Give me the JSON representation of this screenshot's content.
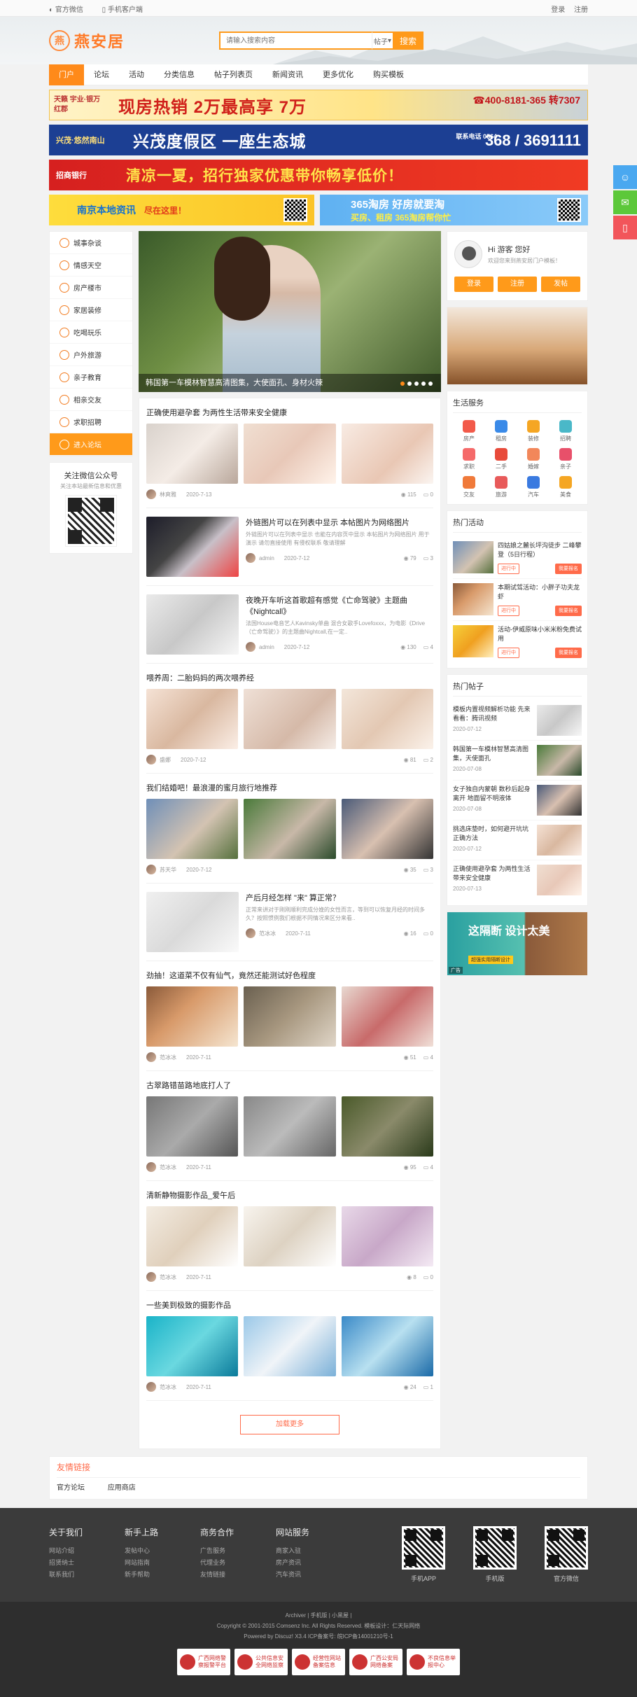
{
  "topbar": {
    "wechat": "官方微信",
    "mobile": "手机客户端",
    "login": "登录",
    "register": "注册"
  },
  "header": {
    "logo_char": "燕",
    "logo_text": "燕安居",
    "search_placeholder": "请输入搜索内容",
    "search_scope": "帖子",
    "search_button": "搜索"
  },
  "nav": [
    "门户",
    "论坛",
    "活动",
    "分类信息",
    "帖子列表页",
    "新闻资讯",
    "更多优化",
    "购买模板"
  ],
  "banners": {
    "b1_logo": "天籁 宇业·银万红郡",
    "b1_text": "现房热销 2万最高享 7万",
    "b1_phone": "☎400-8181-365 转7307",
    "b2_logo": "兴茂·悠然南山",
    "b2_text": "兴茂度假区 一座生态城",
    "b2_small": "联系电话 0564",
    "b2_phone": "368 / 3691111",
    "b3_logo": "招商银行",
    "b3_text": "清凉一夏，招行独家优惠带你畅享低价！",
    "b4a_text": "南京本地资讯",
    "b4a_sub": "尽在这里！",
    "b4b_text": "365淘房 好房就要淘",
    "b4b_sub": "买房、租房 365淘房帮你忙"
  },
  "left_nav": [
    "城事杂谈",
    "情感天空",
    "房产楼市",
    "家居装修",
    "吃喝玩乐",
    "户外旅游",
    "亲子教育",
    "相亲交友",
    "求职招聘",
    "进入论坛"
  ],
  "wechat_box": {
    "title": "关注微信公众号",
    "sub": "关注本站最新信息和优惠"
  },
  "slider": {
    "caption": "韩国第一车模林智慧高清图集，大使面孔、身材火辣"
  },
  "posts": [
    {
      "title": "正确使用避孕套 为两性生活带来安全健康",
      "author": "林爽雅",
      "date": "2020-7-13",
      "views": "115",
      "comments": "0"
    },
    {
      "title": "外链图片可以在列表中显示 本帖图片为网络图片",
      "desc": "外链图片可以在列表中显示 也能在内容页中显示 本帖图片为网络图片 用于演示 请勿直接使用 有侵权联系 敬请理解",
      "author": "admin",
      "date": "2020-7-12",
      "views": "79",
      "comments": "3"
    },
    {
      "title": "夜晚开车听这首歌超有感觉《亡命驾驶》主题曲《Nightcall》",
      "desc": "法国House电音艺人Kavinsky单曲 混合女歌手Lovefoxxx，为电影《Drive（亡命驾驶）》的主题曲Nightcall,在一定..",
      "author": "admin",
      "date": "2020-7-12",
      "views": "130",
      "comments": "4"
    },
    {
      "title": "喂养周：二胎妈妈的两次喂养经",
      "author": "盛娜",
      "date": "2020-7-12",
      "views": "81",
      "comments": "2"
    },
    {
      "title": "我们结婚吧！最浪漫的蜜月旅行地推荐",
      "author": "苏天华",
      "date": "2020-7-12",
      "views": "35",
      "comments": "3"
    },
    {
      "title": "产后月经怎样 \"来\" 算正常？",
      "desc": "正常来讲对于刚刚顺利完成分娩的女性而言，等到可以恢复月经的时间多久？按照惯例我们根据不同情况来区分来看..",
      "author": "范冰冰",
      "date": "2020-7-11",
      "views": "16",
      "comments": "0"
    },
    {
      "title": "劲抽！这道菜不仅有仙气，竟然还能测试好色程度",
      "author": "范冰冰",
      "date": "2020-7-11",
      "views": "51",
      "comments": "4"
    },
    {
      "title": "古翠路错苗路地底打人了",
      "author": "范冰冰",
      "date": "2020-7-11",
      "views": "95",
      "comments": "4"
    },
    {
      "title": "清新静物摄影作品_爱午后",
      "author": "范冰冰",
      "date": "2020-7-11",
      "views": "8",
      "comments": "0"
    },
    {
      "title": "一些美到极致的摄影作品",
      "author": "范冰冰",
      "date": "2020-7-11",
      "views": "24",
      "comments": "1"
    }
  ],
  "load_more": "加载更多",
  "user": {
    "greeting": "Hi 游客 您好",
    "welcome": "欢迎您来到燕安居门户模板！",
    "btn_login": "登录",
    "btn_register": "注册",
    "btn_post": "发帖"
  },
  "services": {
    "title": "生活服务",
    "items": [
      "房产",
      "租房",
      "装修",
      "招聘",
      "求职",
      "二手",
      "婚嫁",
      "亲子",
      "交友",
      "旅游",
      "汽车",
      "美食"
    ]
  },
  "activities": {
    "title": "热门活动",
    "items": [
      {
        "title": "四姑娘之麓长坪沟徒步 二峰攀登（5日行程）",
        "status": "进行中",
        "btn": "我要报名"
      },
      {
        "title": "本期试驾活动：小胖子功夫龙虾",
        "status": "进行中",
        "btn": "我要报名"
      },
      {
        "title": "活动-伊威原味小米米粉免费试用",
        "status": "进行中",
        "btn": "我要报名"
      }
    ]
  },
  "hot_posts": {
    "title": "热门帖子",
    "items": [
      {
        "title": "模板内置视频解析功能 先来看看：腾讯视频",
        "date": "2020-07-12"
      },
      {
        "title": "韩国第一车模林智慧高清图集，天使面孔",
        "date": "2020-07-08"
      },
      {
        "title": "女子独自内蒙朝 数秒后起身离开 地面留不明液体",
        "date": "2020-07-08"
      },
      {
        "title": "挑选床垫时，如何避开坑坑正确方法",
        "date": "2020-07-12"
      },
      {
        "title": "正确使用避孕套 为两性生活带来安全健康",
        "date": "2020-07-13"
      }
    ]
  },
  "ad_right": {
    "text": "这隔断 设计太美",
    "sub": "超强实用隔断设计",
    "tag": "广告"
  },
  "friend_links": {
    "title": "友情链接",
    "items": [
      "官方论坛",
      "应用商店"
    ]
  },
  "footer": {
    "cols": [
      {
        "title": "关于我们",
        "links": [
          "网站介绍",
          "招贤纳士",
          "联系我们"
        ]
      },
      {
        "title": "新手上路",
        "links": [
          "发帖中心",
          "网站指南",
          "新手帮助"
        ]
      },
      {
        "title": "商务合作",
        "links": [
          "广告服务",
          "代理业务",
          "友情链接"
        ]
      },
      {
        "title": "网站服务",
        "links": [
          "商家入驻",
          "房产资讯",
          "汽车资讯"
        ]
      }
    ],
    "qrs": [
      "手机APP",
      "手机版",
      "官方微信"
    ]
  },
  "copyright": {
    "line1": "Archiver | 手机版 | 小黑屋 |",
    "line2": "Copyright © 2001-2015 Comsenz Inc. All Rights Reserved.  模板设计：仁天际网络",
    "line3": "Powered by Discuz! X3.4  ICP备案号: 皖ICP备14001210号-1",
    "badges": [
      "广西网络警察报警平台",
      "公共信息安全网络监察",
      "经营性网站备案信息",
      "广西公安局网络备案",
      "不良信息举报中心"
    ]
  },
  "colors": {
    "accent": "#ff9a1a",
    "nav_active": "#ff8a1a",
    "link_red": "#ff6b4a"
  }
}
